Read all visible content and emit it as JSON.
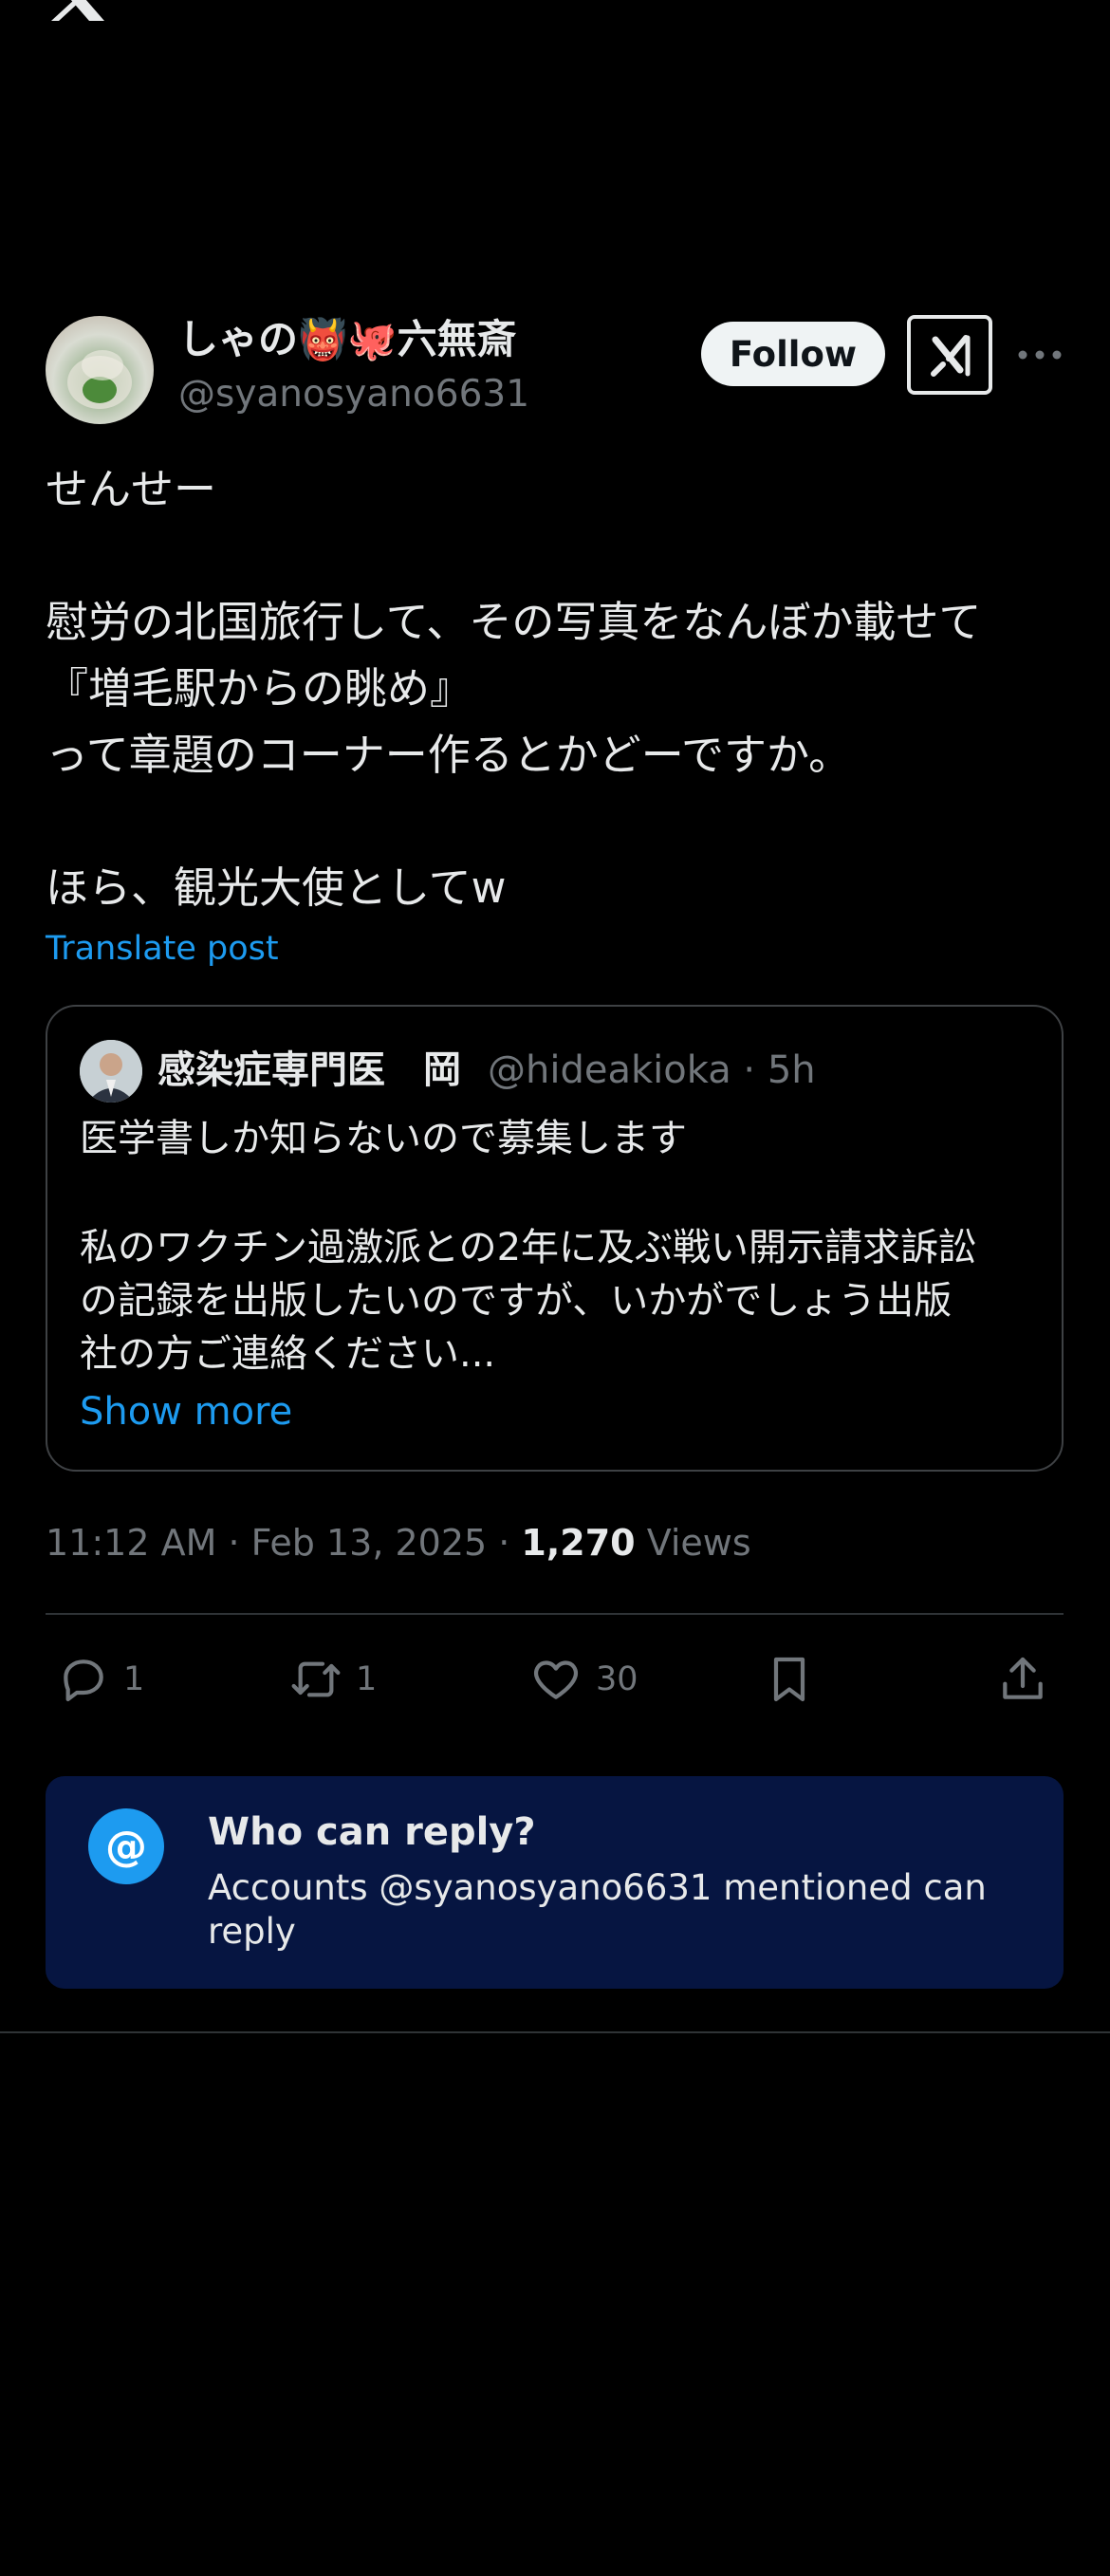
{
  "author": {
    "name_prefix": "しゃの",
    "emoji_1": "👹",
    "emoji_2": "🐙",
    "name_suffix": "六無斎",
    "handle": "@syanosyano6631"
  },
  "buttons": {
    "follow": "Follow"
  },
  "post": {
    "lines": [
      "せんせー",
      "",
      "慰労の北国旅行して、その写真をなんぼか載せて",
      "『増毛駅からの眺め』",
      "って章題のコーナー作るとかどーですか。",
      "",
      "ほら、観光大使としてw"
    ],
    "translate": "Translate post"
  },
  "quote": {
    "name": "感染症専門医　岡",
    "handle_time": "@hideakioka · 5h",
    "lines": [
      "医学書しか知らないので募集します",
      "",
      "私のワクチン過激派との2年に及ぶ戦い開示請求訴訟",
      "の記録を出版したいのですが、いかがでしょう出版",
      "社の方ご連絡ください..."
    ],
    "show_more": "Show more"
  },
  "meta": {
    "time": "11:12 AM · Feb 13, 2025 · ",
    "views_count": "1,270",
    "views_label": " Views"
  },
  "actions": {
    "replies": "1",
    "reposts": "1",
    "likes": "30"
  },
  "reply_restriction": {
    "icon": "@",
    "title": "Who can reply?",
    "description": "Accounts @syanosyano6631 mentioned can reply"
  },
  "colors": {
    "background": "#000000",
    "accent": "#1d9bf0",
    "muted_text": "#71767b",
    "reply_box": "#061541"
  }
}
